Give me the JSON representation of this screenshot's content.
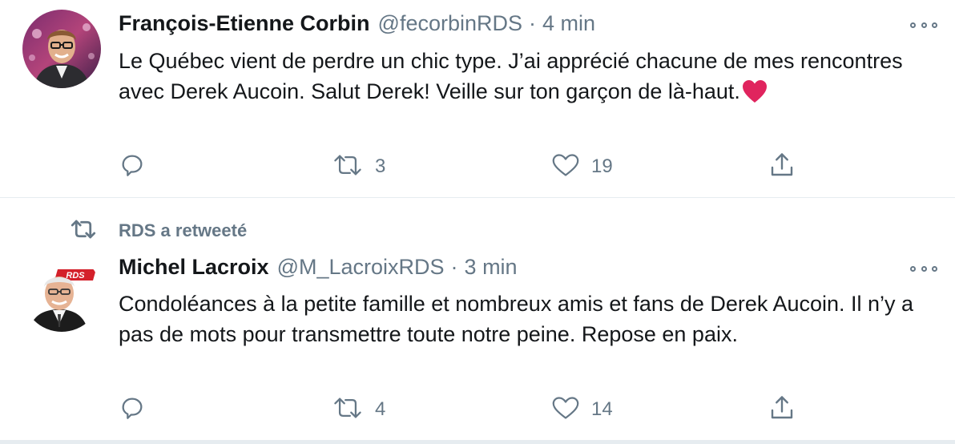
{
  "tweets": [
    {
      "author_name": "François-Etienne Corbin",
      "handle": "@fecorbinRDS",
      "separator": "·",
      "time": "4 min",
      "text": "Le Québec vient de perdre un chic type. J’ai apprécié chacune de mes rencontres avec Derek Aucoin. Salut Derek! Veille sur ton garçon de là-haut.",
      "emoji": "red-heart-emoji",
      "reply_count": "",
      "retweet_count": "3",
      "like_count": "19"
    },
    {
      "retweet_context": "RDS a retweeté",
      "author_name": "Michel Lacroix",
      "handle": "@M_LacroixRDS",
      "separator": "·",
      "time": "3 min",
      "text": "Condoléances à la petite famille et nombreux amis et fans de Derek Aucoin. Il n’y a pas de mots pour transmettre toute notre peine. Repose en paix.",
      "avatar_logo": "RDS",
      "reply_count": "",
      "retweet_count": "4",
      "like_count": "14"
    }
  ],
  "colors": {
    "text": "#14171a",
    "secondary": "#657786",
    "divider": "#e6ecf0",
    "heart": "#e0245e",
    "rds_red": "#d4202a"
  },
  "icons": [
    "reply-icon",
    "retweet-icon",
    "like-icon",
    "share-icon",
    "more-icon"
  ]
}
